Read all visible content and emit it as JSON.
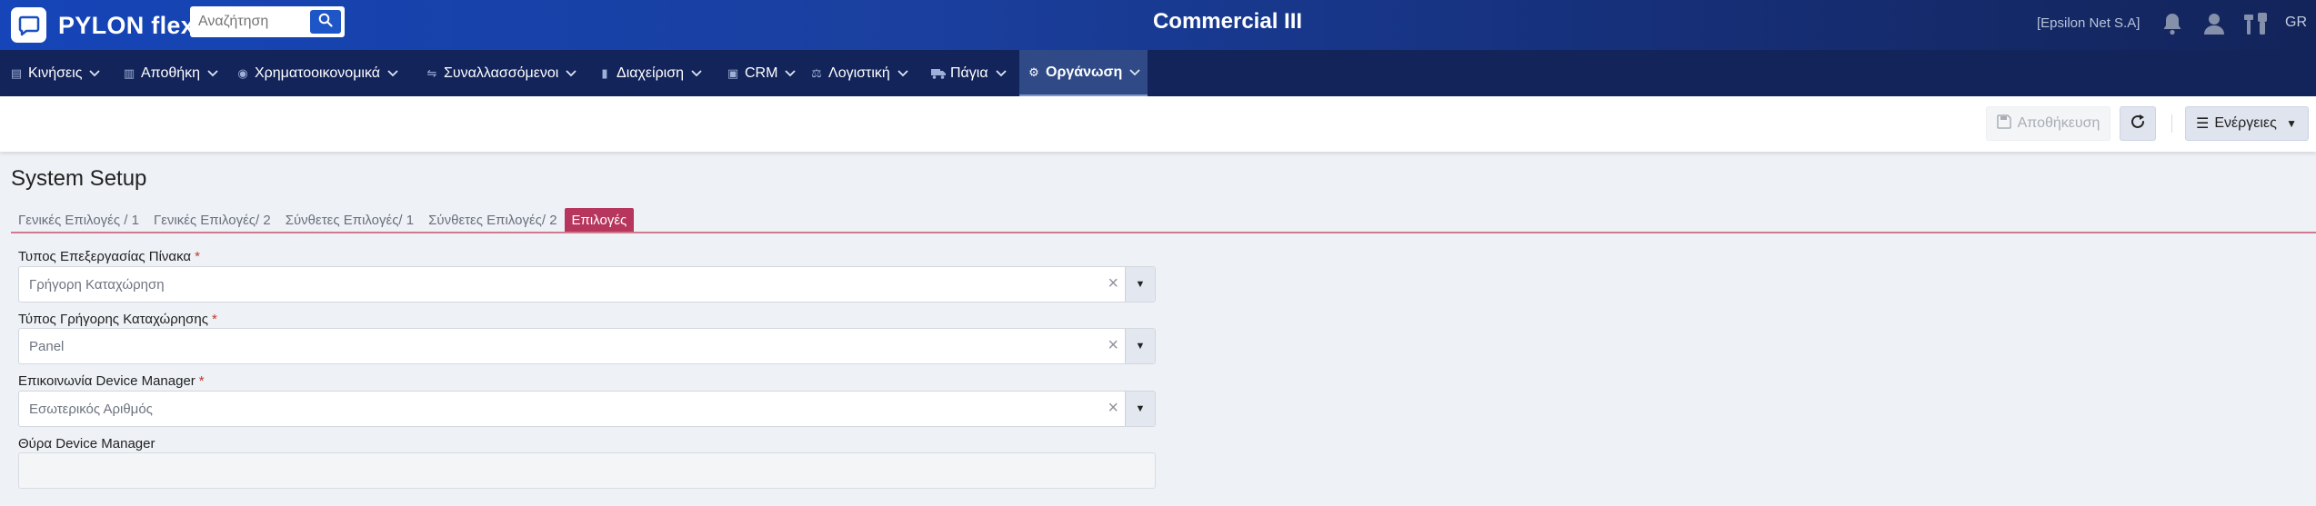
{
  "header": {
    "logo_text": "PYLON flex",
    "search_placeholder": "Αναζήτηση",
    "app_title": "Commercial III",
    "company": "[Epsilon Net S.A]",
    "language": "GR",
    "icons": [
      "bell-icon",
      "user-icon",
      "tools-icon"
    ]
  },
  "nav": {
    "items": [
      {
        "label": "Κινήσεις",
        "icon": "ledger-icon"
      },
      {
        "label": "Αποθήκη",
        "icon": "warehouse-icon"
      },
      {
        "label": "Χρηματοοικονομικά",
        "icon": "coins-icon"
      },
      {
        "label": "Συναλλασσόμενοι",
        "icon": "handshake-icon"
      },
      {
        "label": "Διαχείριση",
        "icon": "book-icon"
      },
      {
        "label": "CRM",
        "icon": "id-card-icon"
      },
      {
        "label": "Λογιστική",
        "icon": "balance-icon"
      },
      {
        "label": "Πάγια",
        "icon": "truck-icon"
      },
      {
        "label": "Οργάνωση",
        "icon": "gear-icon",
        "active": true
      }
    ]
  },
  "toolbar": {
    "save_label": "Αποθήκευση",
    "actions_label": "Ενέργειες"
  },
  "page": {
    "title": "System Setup",
    "tabs": [
      {
        "label": "Γενικές Επιλογές / 1"
      },
      {
        "label": "Γενικές Επιλογές/ 2"
      },
      {
        "label": "Σύνθετες Επιλογές/ 1"
      },
      {
        "label": "Σύνθετες Επιλογές/ 2"
      },
      {
        "label": "Επιλογές",
        "active": true
      }
    ],
    "fields": [
      {
        "label": "Τυπος Επεξεργασίας Πίνακα",
        "required": "*",
        "value": "Γρήγορη Καταχώρηση"
      },
      {
        "label": "Τύπος Γρήγορης Καταχώρησης",
        "required": "*",
        "value": "Panel"
      },
      {
        "label": "Επικοινωνία Device Manager",
        "required": "*",
        "value": "Εσωτερικός Αριθμός"
      },
      {
        "label": "Θύρα Device Manager",
        "value": ""
      }
    ]
  },
  "colors": {
    "header_start": "#1545b8",
    "header_end": "#13245a",
    "nav_bg": "#13245a",
    "active_tab": "#b6365d",
    "required": "#c0392b"
  }
}
